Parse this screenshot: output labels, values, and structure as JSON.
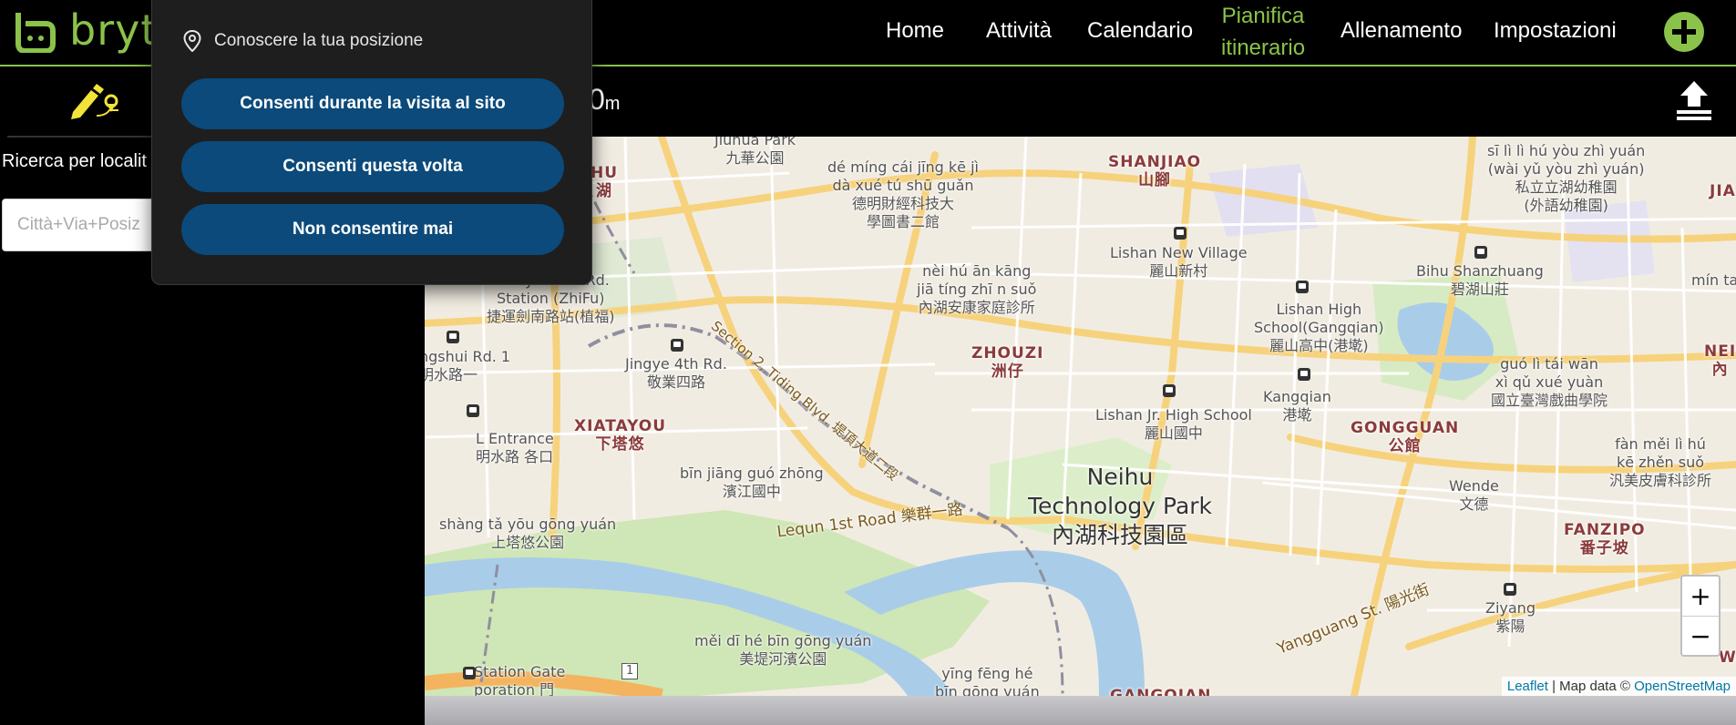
{
  "app": {
    "logo_text": "brytc"
  },
  "nav": {
    "items": [
      "Home",
      "Attività",
      "Calendario",
      "Allenamento",
      "Impostazioni"
    ],
    "active_line1": "Pianifica",
    "active_line2": "itinerario"
  },
  "panel": {
    "search_label": "Ricerca per localit",
    "search_placeholder": "Città+Via+Posiz"
  },
  "route": {
    "distance_value": "0",
    "distance_unit": "m"
  },
  "permission": {
    "question": "Conoscere la tua posizione",
    "allow_visit": "Consenti durante la visita al sito",
    "allow_once": "Consenti questa volta",
    "never": "Non consentire mai"
  },
  "map": {
    "labels": {
      "jiuhua_park_a": "Jiuhua Park",
      "jiuhua_park_b": "九華公園",
      "deming_a": "dé míng cái jīng kē jì",
      "deming_b": "dà xué tú shū guǎn",
      "deming_c": "德明財經科技大",
      "deming_d": "學圖書二館",
      "shanjiao_a": "SHANJIAO",
      "shanjiao_b": "山腳",
      "sili_a": "sī lì lì hú yòu zhì yuán",
      "sili_b": "(wài yǔ yòu zhì yuán)",
      "sili_c": "私立立湖幼稚園",
      "sili_d": "(外語幼稚園)",
      "neihu_w_a": "HU",
      "neihu_w_b": "湖",
      "jiantan_a": "MRT Jiannan Rd.",
      "jiantan_b": "Station (ZhiFu)",
      "jiantan_c": "捷運劍南路站(植福)",
      "neihu_care_a": "nèi hú ān kāng",
      "neihu_care_b": "jiā tíng zhī n suǒ",
      "neihu_care_c": "內湖安康家庭診所",
      "lishan_nv_a": "Lishan New Village",
      "lishan_nv_b": "麗山新村",
      "bihu_a": "Bihu Shanzhuang",
      "bihu_b": "碧湖山莊",
      "lishan_hs_a": "Lishan High",
      "lishan_hs_b": "School(Gangqian)",
      "lishan_hs_c": "麗山高中(港墘)",
      "jingye_a": "Jingye 4th Rd.",
      "jingye_b": "敬業四路",
      "zhouzi_a": "ZHOUZI",
      "zhouzi_b": "洲仔",
      "guoli_a": "guó lì tái wān",
      "guoli_b": "xì qǔ xué yuàn",
      "guoli_c": "國立臺灣戲曲學院",
      "mingshui_a": "ngshui Rd. 1",
      "mingshui_b": "明水路一",
      "xiatayou_a": "XIATAYOU",
      "xiatayou_b": "下塔悠",
      "kangqian_a": "Kangqian",
      "kangqian_b": "港墘",
      "lishan_jr_a": "Lishan Jr. High School",
      "lishan_jr_b": "麗山國中",
      "gongguan_a": "GONGGUAN",
      "gongguan_b": "公館",
      "fanmei_a": "fàn měi lì hú",
      "fanmei_b": "kē zhěn suǒ",
      "fanmei_c": "汎美皮膚科診所",
      "entrance_a": "L Entrance",
      "entrance_b": "明水路",
      "entrance_c": "各口",
      "binjiang_a": "bīn jiāng guó zhōng",
      "binjiang_b": "濱江國中",
      "ntp_a": "Neihu",
      "ntp_b": "Technology Park",
      "ntp_c": "內湖科技園區",
      "wende_a": "Wende",
      "wende_b": "文德",
      "shangta_a": "shàng tǎ yōu gōng yuán",
      "shangta_b": "上塔悠公園",
      "lequn": "Lequn 1st Road 樂群一路",
      "fanzipo_a": "FANZIPO",
      "fanzipo_b": "番子坡",
      "tiding": "Section 2, Tiding Blvd. 堤頂大道二段",
      "ziyang_a": "Ziyang",
      "ziyang_b": "紫陽",
      "meidi_a": "měi dī hé bīn gōng yuán",
      "meidi_b": "美堤河濱公園",
      "yangguang": "Yangguang St. 陽光街",
      "yingfeng_a": "yīng fēng hé",
      "yingfeng_b": "bīn gōng yuán",
      "station_a": "Station Gate",
      "station_b": "poration 門",
      "gangqian_bottom": "GANGQIAN",
      "min_ta": "mín ta",
      "nei_e": "NEI",
      "nei_e2": "內",
      "jia_e": "JIA",
      "wa_e": "WA",
      "marker_1": "1"
    },
    "zoom_in": "+",
    "zoom_out": "−",
    "attribution_leaflet": "Leaflet",
    "attribution_mid": " | Map data © ",
    "attribution_osm": "OpenStreetMap"
  },
  "icons": {
    "logo": "brand-logo-icon",
    "add": "plus-circle-icon",
    "edit": "pencil-route-icon",
    "upload": "upload-icon",
    "location": "location-pin-icon"
  },
  "colors": {
    "accent": "#8bc34a",
    "perm_button": "#0b4a7a",
    "popup_bg": "#1e1e1e"
  }
}
